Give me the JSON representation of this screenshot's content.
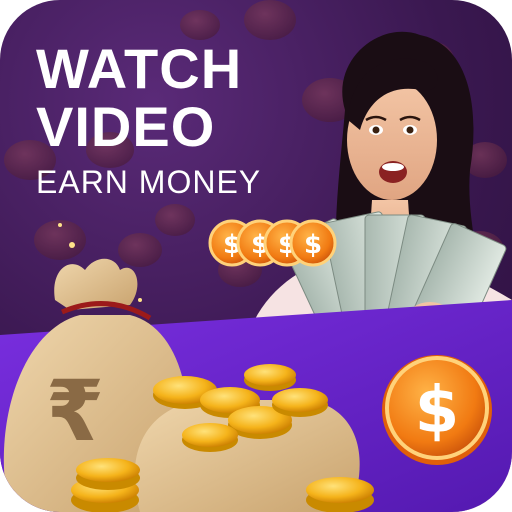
{
  "headline": {
    "line1": "WATCH",
    "line2": "VIDEO",
    "line3": "EARN MONEY"
  },
  "currency_symbols": {
    "rupee": "₹",
    "dollar": "$"
  },
  "colors": {
    "background_purple": "#3a1850",
    "banner_purple": "#6a23c9",
    "coin_gold": "#f5b31a",
    "coin_orange": "#f17a12",
    "bag_tan": "#d8b98a",
    "text_white": "#ffffff"
  }
}
